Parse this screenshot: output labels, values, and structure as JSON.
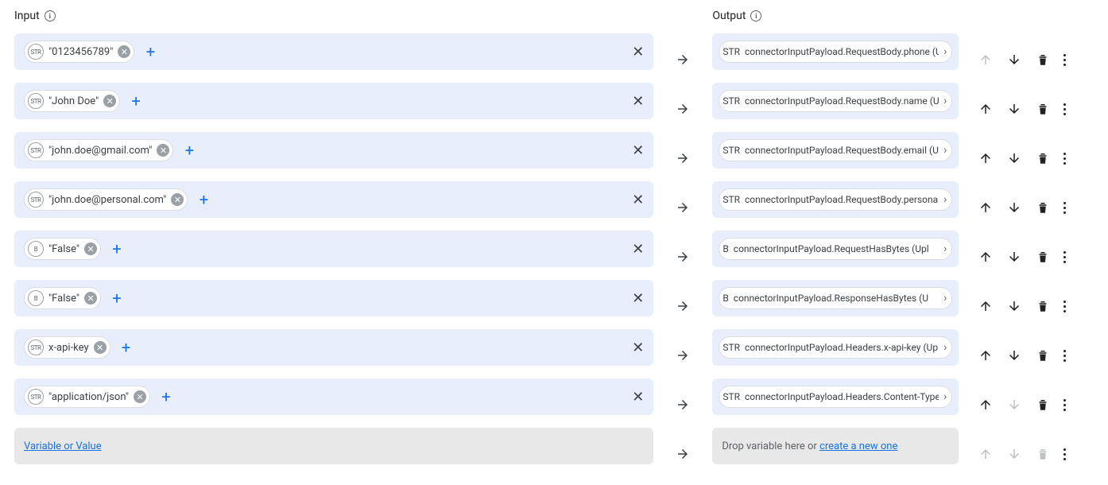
{
  "headers": {
    "input": "Input",
    "output": "Output"
  },
  "rows": [
    {
      "type": "STR",
      "value": "\"0123456789\"",
      "out_type": "STR",
      "out_label": "connectorInputPayload.RequestBody.phone (U",
      "up": false,
      "down": true,
      "del": true
    },
    {
      "type": "STR",
      "value": "\"John Doe\"",
      "out_type": "STR",
      "out_label": "connectorInputPayload.RequestBody.name (U",
      "up": true,
      "down": true,
      "del": true
    },
    {
      "type": "STR",
      "value": "\"john.doe@gmail.com\"",
      "out_type": "STR",
      "out_label": "connectorInputPayload.RequestBody.email (U",
      "up": true,
      "down": true,
      "del": true
    },
    {
      "type": "STR",
      "value": "\"john.doe@personal.com\"",
      "out_type": "STR",
      "out_label": "connectorInputPayload.RequestBody.personal",
      "up": true,
      "down": true,
      "del": true
    },
    {
      "type": "B",
      "value": "\"False\"",
      "out_type": "B",
      "out_label": "connectorInputPayload.RequestHasBytes (Upl",
      "up": true,
      "down": true,
      "del": true
    },
    {
      "type": "B",
      "value": "\"False\"",
      "out_type": "B",
      "out_label": "connectorInputPayload.ResponseHasBytes (U",
      "up": true,
      "down": true,
      "del": true
    },
    {
      "type": "STR",
      "value": "x-api-key",
      "out_type": "STR",
      "out_label": "connectorInputPayload.Headers.x-api-key (Upl",
      "up": true,
      "down": true,
      "del": true
    },
    {
      "type": "STR",
      "value": "\"application/json\"",
      "out_type": "STR",
      "out_label": "connectorInputPayload.Headers.Content-Type",
      "up": true,
      "down": false,
      "del": true
    }
  ],
  "placeholder": {
    "input": "Variable or Value",
    "out_prefix": "Drop variable here or ",
    "out_link": "create a new one"
  }
}
